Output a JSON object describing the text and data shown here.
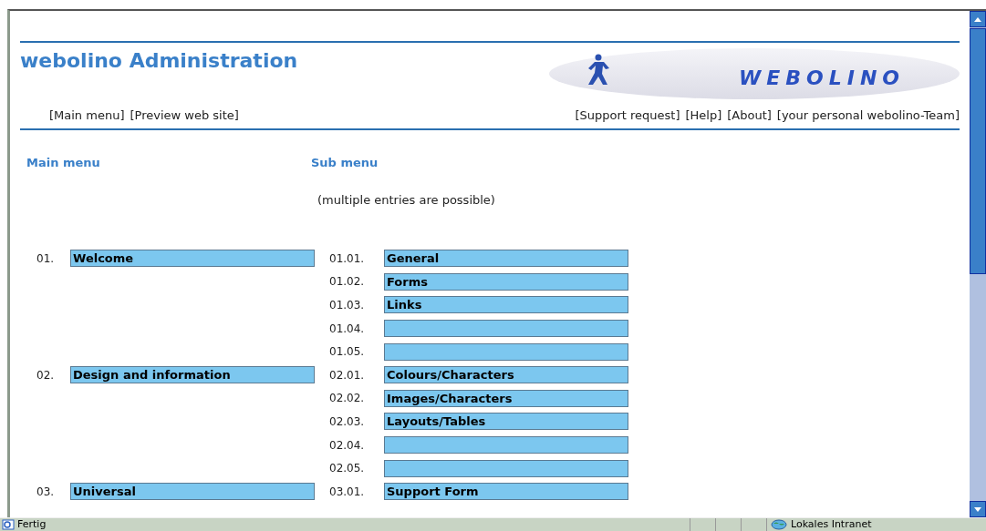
{
  "header": {
    "title": "webolino Administration",
    "logo_text": "WEBOLINO"
  },
  "nav_left": [
    "[Main menu]",
    "[Preview web site]"
  ],
  "nav_right": [
    "[Support request]",
    "[Help]",
    "[About]",
    "[your personal webolino-Team]"
  ],
  "main_heading": "Main menu",
  "sub_heading": "Sub menu",
  "sub_note": "(multiple entries are possible)",
  "menu": [
    {
      "number": "01.",
      "label": "Welcome",
      "subs": [
        {
          "number": "01.01.",
          "label": "General"
        },
        {
          "number": "01.02.",
          "label": "Forms"
        },
        {
          "number": "01.03.",
          "label": "Links"
        },
        {
          "number": "01.04."
        },
        {
          "number": "01.05."
        }
      ]
    },
    {
      "number": "02.",
      "label": "Design and information",
      "subs": [
        {
          "number": "02.01.",
          "label": "Colours/Characters"
        },
        {
          "number": "02.02.",
          "label": "Images/Characters"
        },
        {
          "number": "02.03.",
          "label": "Layouts/Tables"
        },
        {
          "number": "02.04."
        },
        {
          "number": "02.05."
        }
      ]
    },
    {
      "number": "03.",
      "label": "Universal",
      "subs": [
        {
          "number": "03.01.",
          "label": "Support Form"
        }
      ]
    }
  ],
  "status_bar": {
    "text": "Fertig",
    "zone": "Lokales Intranet"
  }
}
